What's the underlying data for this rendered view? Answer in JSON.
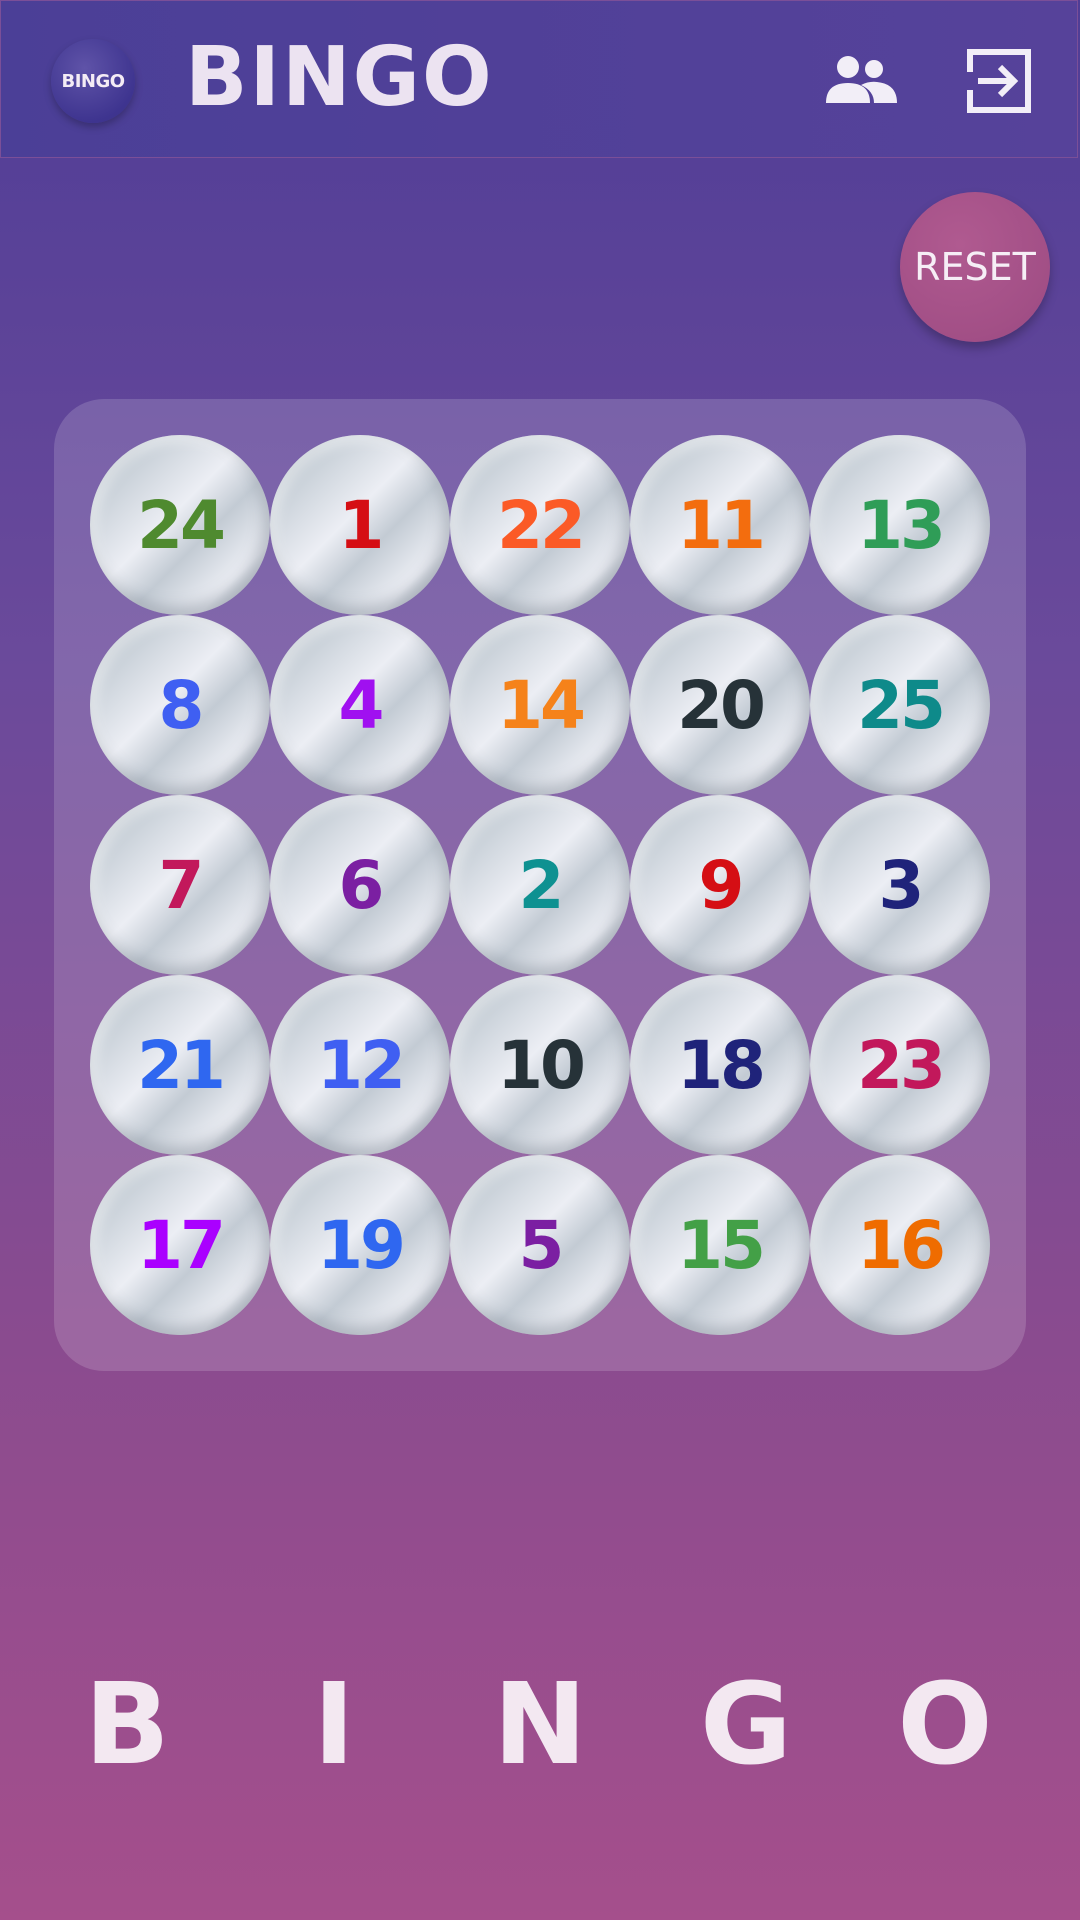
{
  "header": {
    "logo_text": "BINGO",
    "title": "BINGO",
    "players_icon": "players-icon",
    "exit_icon": "exit-icon"
  },
  "reset_button": {
    "label": "RESET"
  },
  "board": {
    "cells": [
      {
        "number": "24",
        "color": "#4f8a2f"
      },
      {
        "number": "1",
        "color": "#d50e14"
      },
      {
        "number": "22",
        "color": "#fb5a26"
      },
      {
        "number": "11",
        "color": "#f36d0e"
      },
      {
        "number": "13",
        "color": "#2f9d57"
      },
      {
        "number": "8",
        "color": "#3f5ff2"
      },
      {
        "number": "4",
        "color": "#a010f0"
      },
      {
        "number": "14",
        "color": "#f5821a"
      },
      {
        "number": "20",
        "color": "#263238"
      },
      {
        "number": "25",
        "color": "#0e8a8a"
      },
      {
        "number": "7",
        "color": "#c2185b"
      },
      {
        "number": "6",
        "color": "#7b1fa2"
      },
      {
        "number": "2",
        "color": "#0e9191"
      },
      {
        "number": "9",
        "color": "#d50e14"
      },
      {
        "number": "3",
        "color": "#1f237a"
      },
      {
        "number": "21",
        "color": "#2f67f0"
      },
      {
        "number": "12",
        "color": "#3f5ff2"
      },
      {
        "number": "10",
        "color": "#263238"
      },
      {
        "number": "18",
        "color": "#1f237a"
      },
      {
        "number": "23",
        "color": "#c2185b"
      },
      {
        "number": "17",
        "color": "#aa00ff"
      },
      {
        "number": "19",
        "color": "#2f67f0"
      },
      {
        "number": "5",
        "color": "#7b1fa2"
      },
      {
        "number": "15",
        "color": "#43a047"
      },
      {
        "number": "16",
        "color": "#ef6c00"
      }
    ]
  },
  "footer": {
    "letters": [
      "B",
      "I",
      "N",
      "G",
      "O"
    ]
  }
}
